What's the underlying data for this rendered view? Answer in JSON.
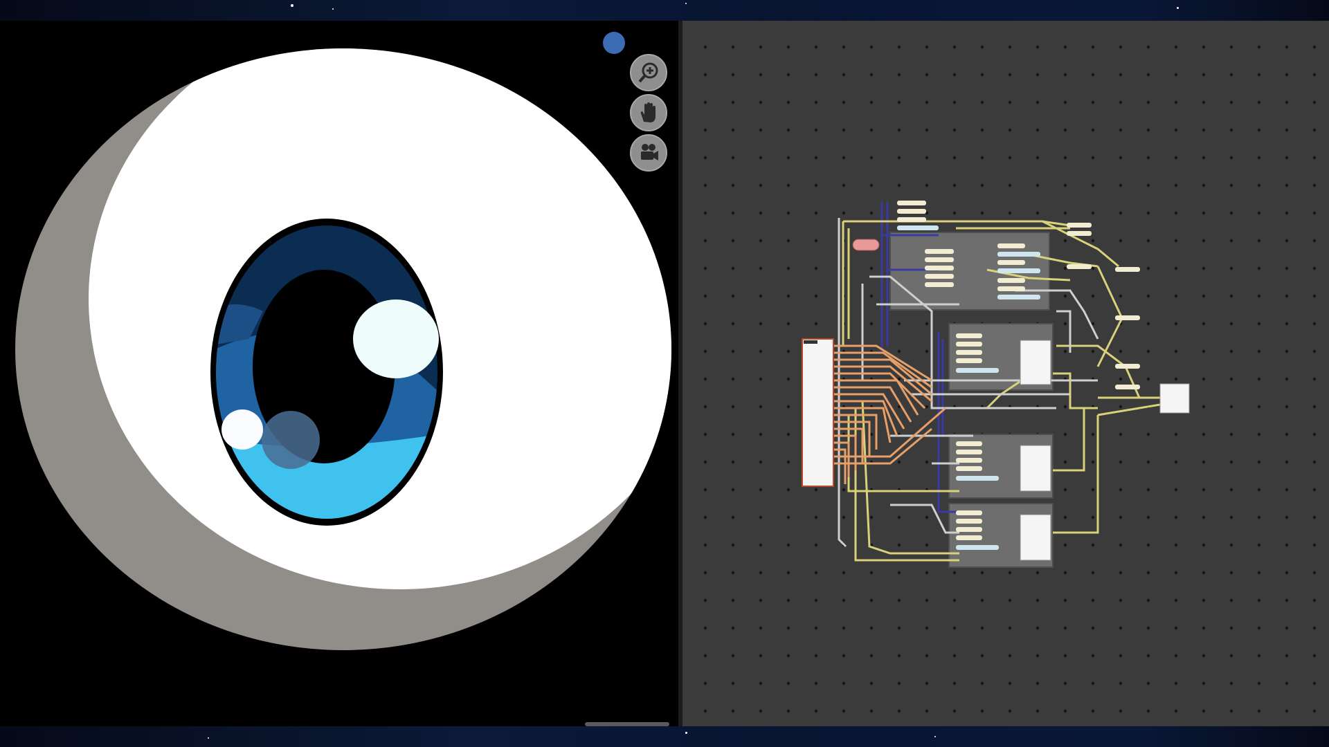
{
  "app": {
    "viewport_tools": [
      {
        "id": "zoom",
        "icon": "zoom-in-icon"
      },
      {
        "id": "pan",
        "icon": "hand-icon"
      },
      {
        "id": "camera",
        "icon": "camera-icon"
      }
    ]
  },
  "graph": {
    "nodes_small": 30,
    "groups": 4
  },
  "colors": {
    "accent": "#3c6db4",
    "graph_bg": "#3b3b3b",
    "wire": "#d9d27a",
    "wire_alt": "#cfcfcf",
    "wire_blue": "#3a3aa0",
    "wire_orange": "#e8a06a",
    "iris_dark": "#0b2d52",
    "iris_mid": "#1f63a3",
    "iris_light": "#3fc3ee"
  }
}
